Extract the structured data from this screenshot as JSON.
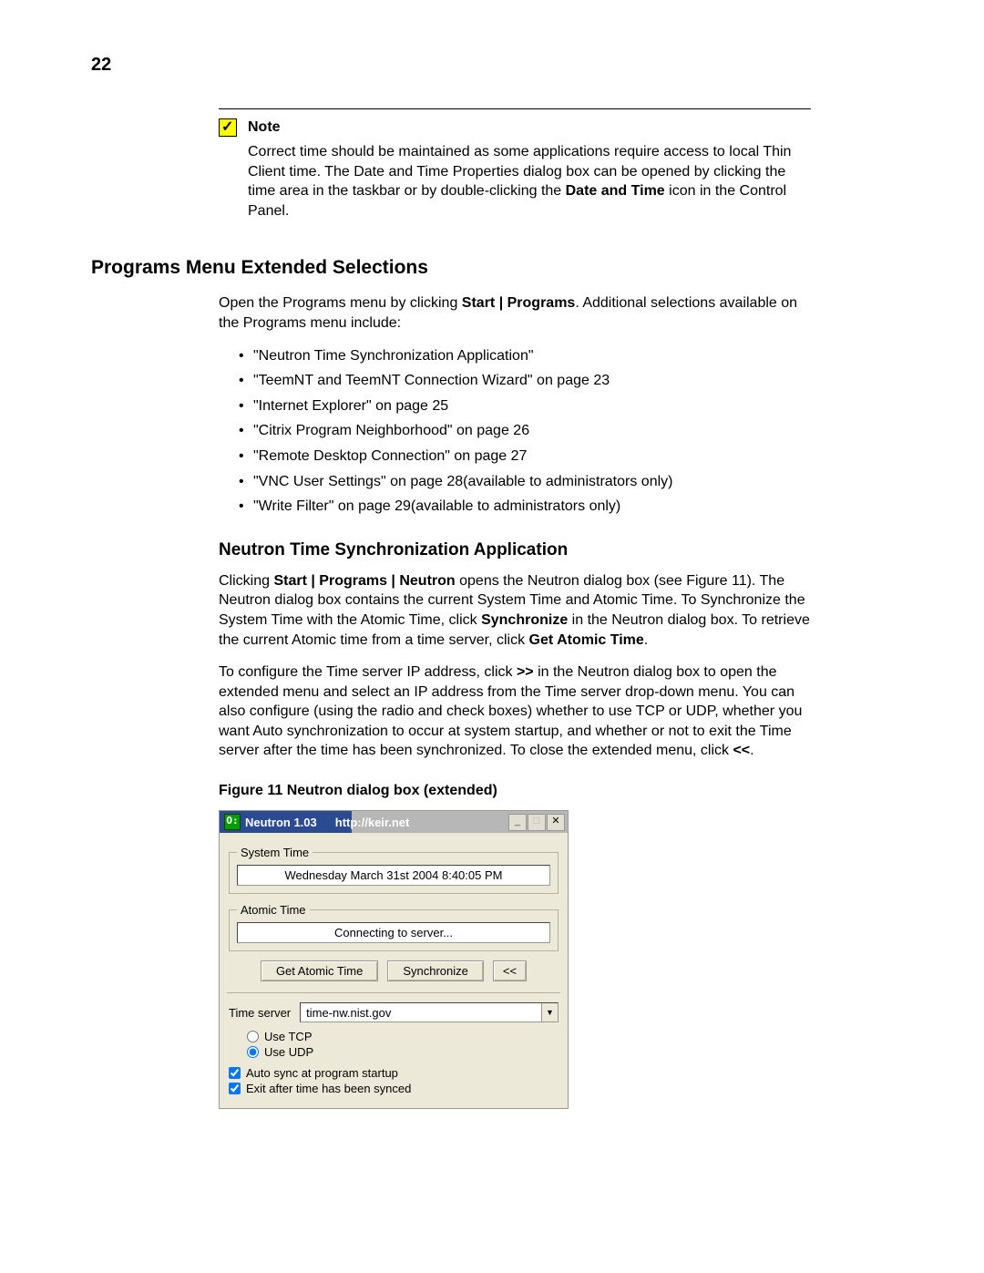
{
  "page_number": "22",
  "note": {
    "label": "Note",
    "body_pre": "Correct time should be maintained as some applications require access to local Thin Client time. The Date and Time Properties dialog box can be opened by clicking the time area in the taskbar or by double-clicking the ",
    "body_bold": "Date and Time",
    "body_post": " icon in the Control Panel."
  },
  "section1": {
    "heading": "Programs Menu Extended Selections",
    "intro_pre": "Open the Programs menu by clicking ",
    "intro_bold": "Start | Programs",
    "intro_post": ". Additional selections available on the Programs menu include:",
    "items": [
      "\"Neutron Time Synchronization Application\"",
      "\"TeemNT and TeemNT Connection Wizard\" on page 23",
      "\"Internet Explorer\" on page 25",
      "\"Citrix Program Neighborhood\" on page 26",
      "\"Remote Desktop Connection\" on page 27",
      "\"VNC User Settings\" on page 28(available to administrators only)",
      "\"Write Filter\" on page 29(available to administrators only)"
    ]
  },
  "section2": {
    "heading": "Neutron Time Synchronization Application",
    "p1_pre": "Clicking ",
    "p1_bold1": "Start | Programs | Neutron",
    "p1_mid1": " opens the Neutron dialog box (see Figure 11). The Neutron dialog box contains the current System Time and Atomic Time. To Synchronize the System Time with the Atomic Time, click ",
    "p1_bold2": "Synchronize",
    "p1_mid2": " in the Neutron dialog box. To retrieve the current Atomic time from a time server, click ",
    "p1_bold3": "Get Atomic Time",
    "p1_post": ".",
    "p2_pre": "To configure the Time server IP address, click ",
    "p2_bold1": ">>",
    "p2_mid": " in the Neutron dialog box to open the extended menu and select an IP address from the Time server drop-down menu. You can also configure (using the radio and check boxes) whether to use TCP or UDP, whether you want Auto synchronization to occur at system startup, and whether or not to exit the Time server after the time has been synchronized. To close the extended menu, click ",
    "p2_bold2": "<<",
    "p2_post": "."
  },
  "figure_caption": "Figure 11    Neutron dialog box (extended)",
  "dialog": {
    "icon_letter": "O:",
    "title": "Neutron 1.03",
    "url": "http://keir.net",
    "minimize": "_",
    "maximize": "□",
    "close": "✕",
    "system_time_label": "System Time",
    "system_time_value": "Wednesday March 31st 2004    8:40:05 PM",
    "atomic_time_label": "Atomic Time",
    "atomic_time_value": "Connecting to server...",
    "btn_get_atomic": "Get Atomic Time",
    "btn_sync": "Synchronize",
    "btn_collapse": "<<",
    "server_label": "Time server",
    "server_value": "time-nw.nist.gov",
    "use_tcp": "Use TCP",
    "use_udp": "Use UDP",
    "auto_sync": "Auto sync at program startup",
    "exit_after": "Exit after time has been synced"
  }
}
